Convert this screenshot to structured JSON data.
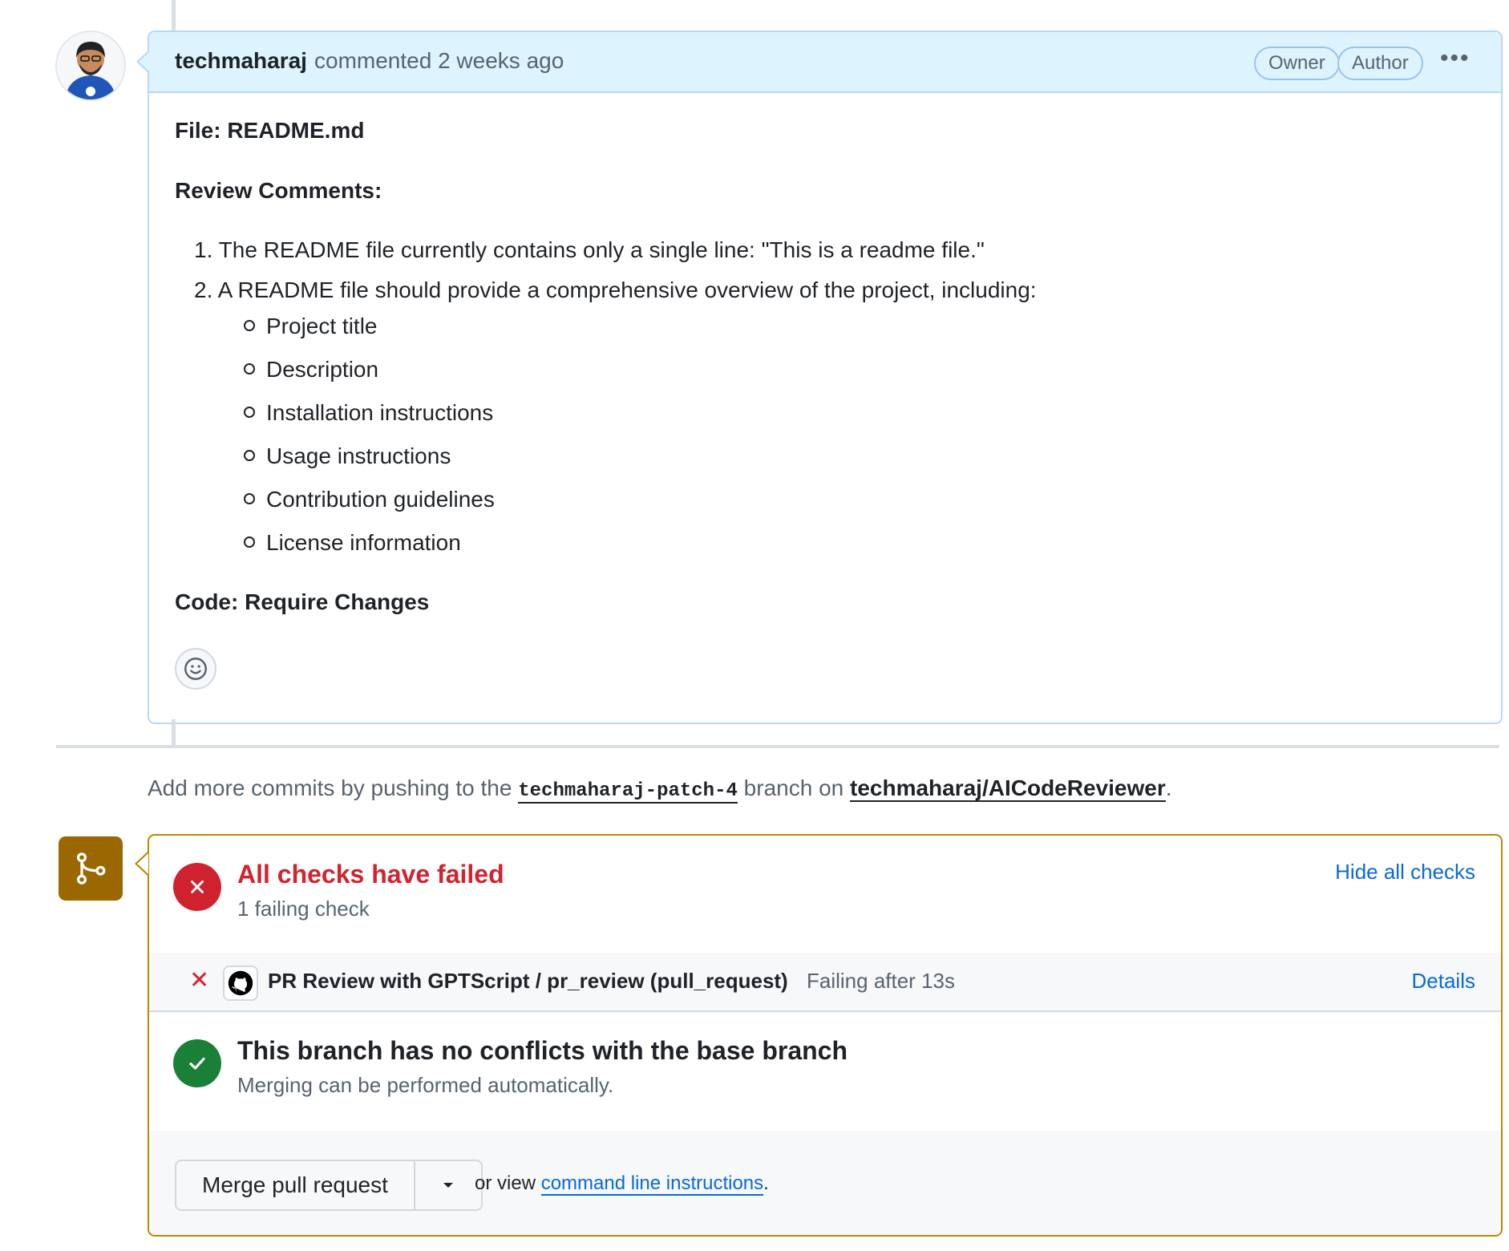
{
  "comment": {
    "author": "techmaharaj",
    "meta": "commented 2 weeks ago",
    "labels": [
      "Owner",
      "Author"
    ],
    "menu_glyph": "•••",
    "file_line": "File: README.md",
    "review_title": "Review Comments:",
    "items": [
      "The README file currently contains only a single line: \"This is a readme file.\"",
      "A README file should provide a comprehensive overview of the project, including:"
    ],
    "item_numbers": [
      "1.",
      "2."
    ],
    "sub_items": [
      "Project title",
      "Description",
      "Installation instructions",
      "Usage instructions",
      "Contribution guidelines",
      "License information"
    ],
    "code_line": "Code: Require Changes"
  },
  "push_info": {
    "prefix": "Add more commits by pushing to the",
    "branch": "techmaharaj-patch-4",
    "middle": "branch on",
    "repo": "techmaharaj/AICodeReviewer",
    "suffix": "."
  },
  "checks": {
    "title": "All checks have failed",
    "subtitle": "1 failing check",
    "toggle_label": "Hide all checks",
    "rows": [
      {
        "name": "PR Review with GPTScript / pr_review (pull_request)",
        "status": "Failing after 13s",
        "link": "Details"
      }
    ]
  },
  "conflicts": {
    "title": "This branch has no conflicts with the base branch",
    "subtitle": "Merging can be performed automatically."
  },
  "merge": {
    "button_label": "Merge pull request",
    "or_view_prefix": "or view",
    "cli_link": "command line instructions",
    "cli_suffix": "."
  },
  "colors": {
    "failure": "#cf222e",
    "success": "#1a7f37",
    "merge_accent": "#9a6700",
    "link": "#0969da"
  }
}
